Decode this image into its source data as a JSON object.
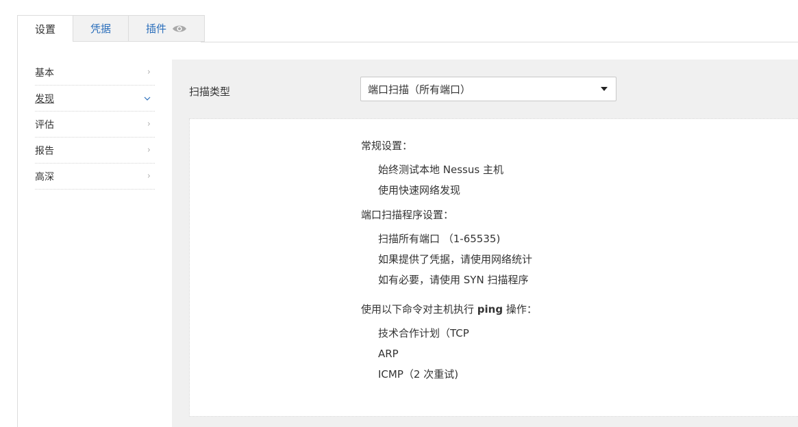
{
  "tabs": [
    {
      "label": "设置",
      "active": true
    },
    {
      "label": "凭据",
      "active": false
    },
    {
      "label": "插件",
      "active": false,
      "icon": "eye-icon"
    }
  ],
  "sidebar": {
    "items": [
      {
        "label": "基本",
        "expanded": false
      },
      {
        "label": "发现",
        "expanded": true
      },
      {
        "label": "评估",
        "expanded": false
      },
      {
        "label": "报告",
        "expanded": false
      },
      {
        "label": "高深",
        "expanded": false
      }
    ]
  },
  "scan_type": {
    "label": "扫描类型",
    "selected": "端口扫描（所有端口）"
  },
  "summary": {
    "general": {
      "title": "常规设置：",
      "items": [
        "始终测试本地 Nessus 主机",
        "使用快速网络发现"
      ]
    },
    "port_scanner": {
      "title": "端口扫描程序设置：",
      "items": [
        "扫描所有端口 （1-65535)",
        "如果提供了凭据，请使用网络统计",
        "如有必要，请使用 SYN 扫描程序"
      ]
    },
    "ping": {
      "title_pre": "使用以下命令对主机执行 ",
      "title_bold": "ping",
      "title_post": " 操作：",
      "items": [
        "技术合作计划（TCP",
        "ARP",
        "ICMP（2 次重试)"
      ]
    }
  },
  "colors": {
    "accent": "#2a6ebb",
    "panel_bg": "#f0f0f0",
    "tab_bg": "#f2f2f2"
  }
}
